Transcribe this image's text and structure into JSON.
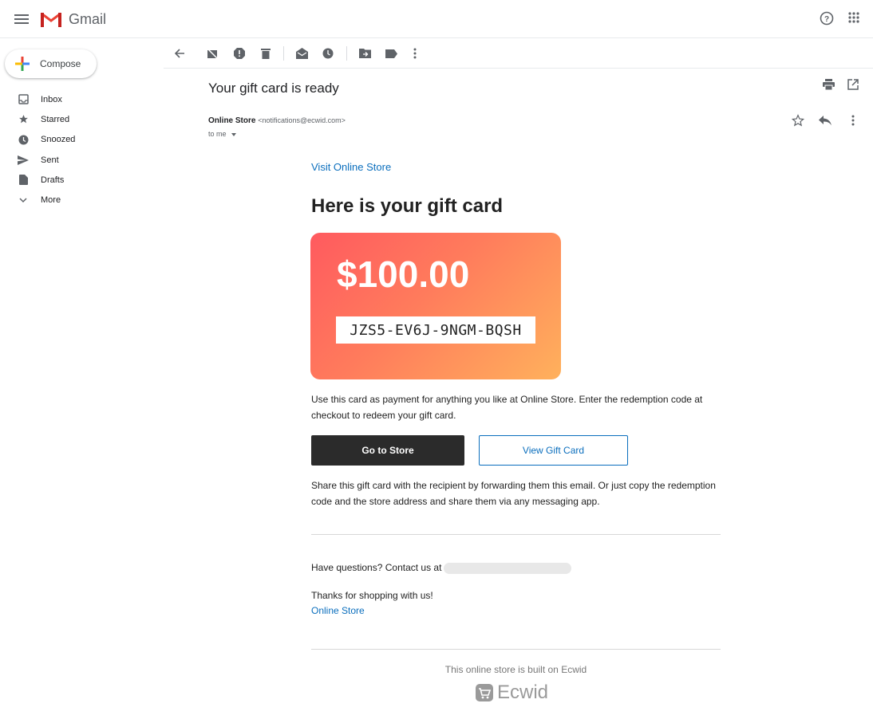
{
  "app": {
    "name": "Gmail"
  },
  "sidebar": {
    "compose_label": "Compose",
    "items": [
      {
        "label": "Inbox",
        "icon": "inbox-icon"
      },
      {
        "label": "Starred",
        "icon": "star-icon"
      },
      {
        "label": "Snoozed",
        "icon": "clock-icon"
      },
      {
        "label": "Sent",
        "icon": "send-icon"
      },
      {
        "label": "Drafts",
        "icon": "draft-icon"
      },
      {
        "label": "More",
        "icon": "chevron-down-icon"
      }
    ]
  },
  "email": {
    "subject": "Your gift card is ready",
    "sender_name": "Online Store",
    "sender_email": "<notifications@ecwid.com>",
    "to": "to me"
  },
  "body": {
    "visit_link": "Visit Online Store",
    "heading": "Here is your gift card",
    "amount": "$100.00",
    "code": "JZS5-EV6J-9NGM-BQSH",
    "instructions": "Use this card as payment for anything you like at Online Store. Enter the redemption code at checkout to redeem your gift card.",
    "go_to_store": "Go to Store",
    "view_gift_card": "View Gift Card",
    "share_text": "Share this gift card with the recipient by forwarding them this email. Or just copy the redemption code and the store address and share them via any messaging app.",
    "questions": "Have questions? Contact us at",
    "thanks": "Thanks for shopping with us!",
    "store_link": "Online Store",
    "built_on": "This online store is built on Ecwid",
    "ecwid_brand": "Ecwid"
  },
  "colors": {
    "link": "#0a6ebd",
    "card_start": "#ff5a5f",
    "card_end": "#ffb15c",
    "dark_button": "#2b2b2b"
  }
}
